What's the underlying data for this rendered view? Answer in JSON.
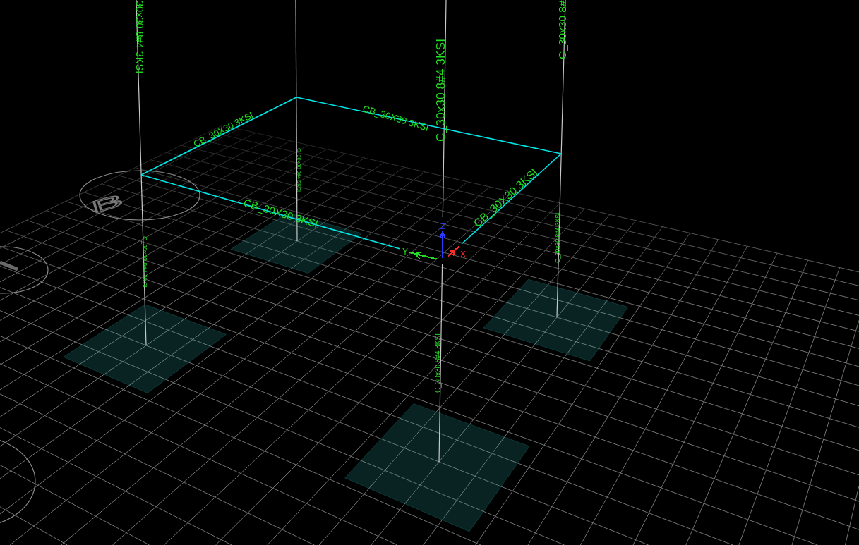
{
  "viewport": {
    "column_labels": [
      "30x30 8#4 3KSI",
      "C_30x30 8#",
      "C_30x30 8#4 3KSI",
      "C_30x30 8#4 3KSI",
      "C_30x30 8#4 3KSI",
      "C_30x30 8#4 3KSI",
      "C_30x30 8#4 3KSI"
    ],
    "beam_labels": [
      "CB_30X30 3KSI",
      "CB_30X30 3KSI",
      "CB_30X30 3KSI",
      "CB_30X30 3KSI"
    ],
    "grid_bubbles": [
      {
        "label": "B"
      }
    ],
    "axes": [
      {
        "label": "Z",
        "color": "#2a3cff"
      },
      {
        "label": "X",
        "color": "#ff2a2a"
      },
      {
        "label": "Y",
        "color": "#22dd22"
      }
    ]
  }
}
